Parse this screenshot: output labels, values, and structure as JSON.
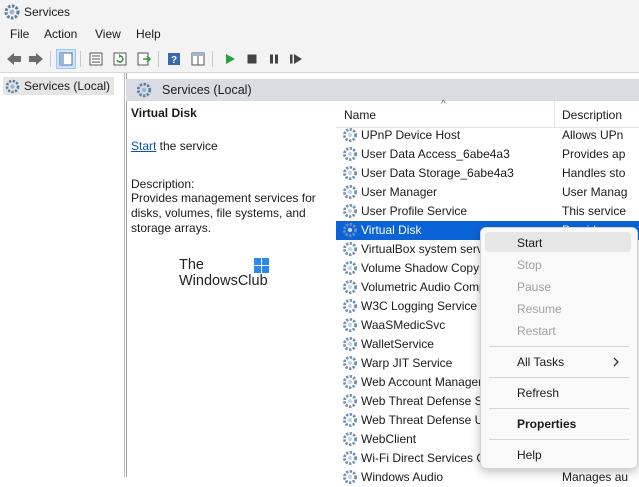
{
  "window": {
    "title": "Services"
  },
  "menubar": [
    "File",
    "Action",
    "View",
    "Help"
  ],
  "toolbar": {
    "icons": [
      "back-icon",
      "forward-icon",
      "show-hide-tree-icon",
      "properties-icon",
      "refresh-icon",
      "export-icon",
      "help-icon",
      "console-tree-icon",
      "start-icon",
      "stop-icon",
      "pause-icon",
      "restart-icon"
    ]
  },
  "tree": {
    "root_label": "Services (Local)"
  },
  "pane": {
    "header": "Services (Local)"
  },
  "description_pane": {
    "title": "Virtual Disk",
    "start_link": "Start",
    "start_suffix": " the service",
    "desc_label": "Description:",
    "desc_text": "Provides management services for disks, volumes, file systems, and storage arrays."
  },
  "columns": {
    "name": "Name",
    "description": "Description"
  },
  "services": [
    {
      "name": "UPnP Device Host",
      "description": "Allows UPn"
    },
    {
      "name": "User Data Access_6abe4a3",
      "description": "Provides ap"
    },
    {
      "name": "User Data Storage_6abe4a3",
      "description": "Handles sto"
    },
    {
      "name": "User Manager",
      "description": "User Manag"
    },
    {
      "name": "User Profile Service",
      "description": "This service"
    },
    {
      "name": "Virtual Disk",
      "description": "Provides m"
    },
    {
      "name": "VirtualBox system service",
      "description": ""
    },
    {
      "name": "Volume Shadow Copy",
      "description": ""
    },
    {
      "name": "Volumetric Audio Compositor Service",
      "description": ""
    },
    {
      "name": "W3C Logging Service",
      "description": ""
    },
    {
      "name": "WaaSMedicSvc",
      "description": ""
    },
    {
      "name": "WalletService",
      "description": ""
    },
    {
      "name": "Warp JIT Service",
      "description": ""
    },
    {
      "name": "Web Account Manager",
      "description": ""
    },
    {
      "name": "Web Threat Defense Service",
      "description": ""
    },
    {
      "name": "Web Threat Defense User Service",
      "description": ""
    },
    {
      "name": "WebClient",
      "description": ""
    },
    {
      "name": "Wi-Fi Direct Services Connection",
      "description": ""
    },
    {
      "name": "Windows Audio",
      "description": "Manages au"
    }
  ],
  "selected_service": "Virtual Disk",
  "context_menu": {
    "start": "Start",
    "stop": "Stop",
    "pause": "Pause",
    "resume": "Resume",
    "restart": "Restart",
    "all_tasks": "All Tasks",
    "refresh": "Refresh",
    "properties": "Properties",
    "help": "Help"
  },
  "watermark": {
    "line1": "The",
    "line2": "WindowsClub"
  },
  "colors": {
    "selection": "#0a64d8",
    "link": "#0b52b6",
    "pane_header": "#d9dde3",
    "chrome": "#f3f3f3"
  }
}
